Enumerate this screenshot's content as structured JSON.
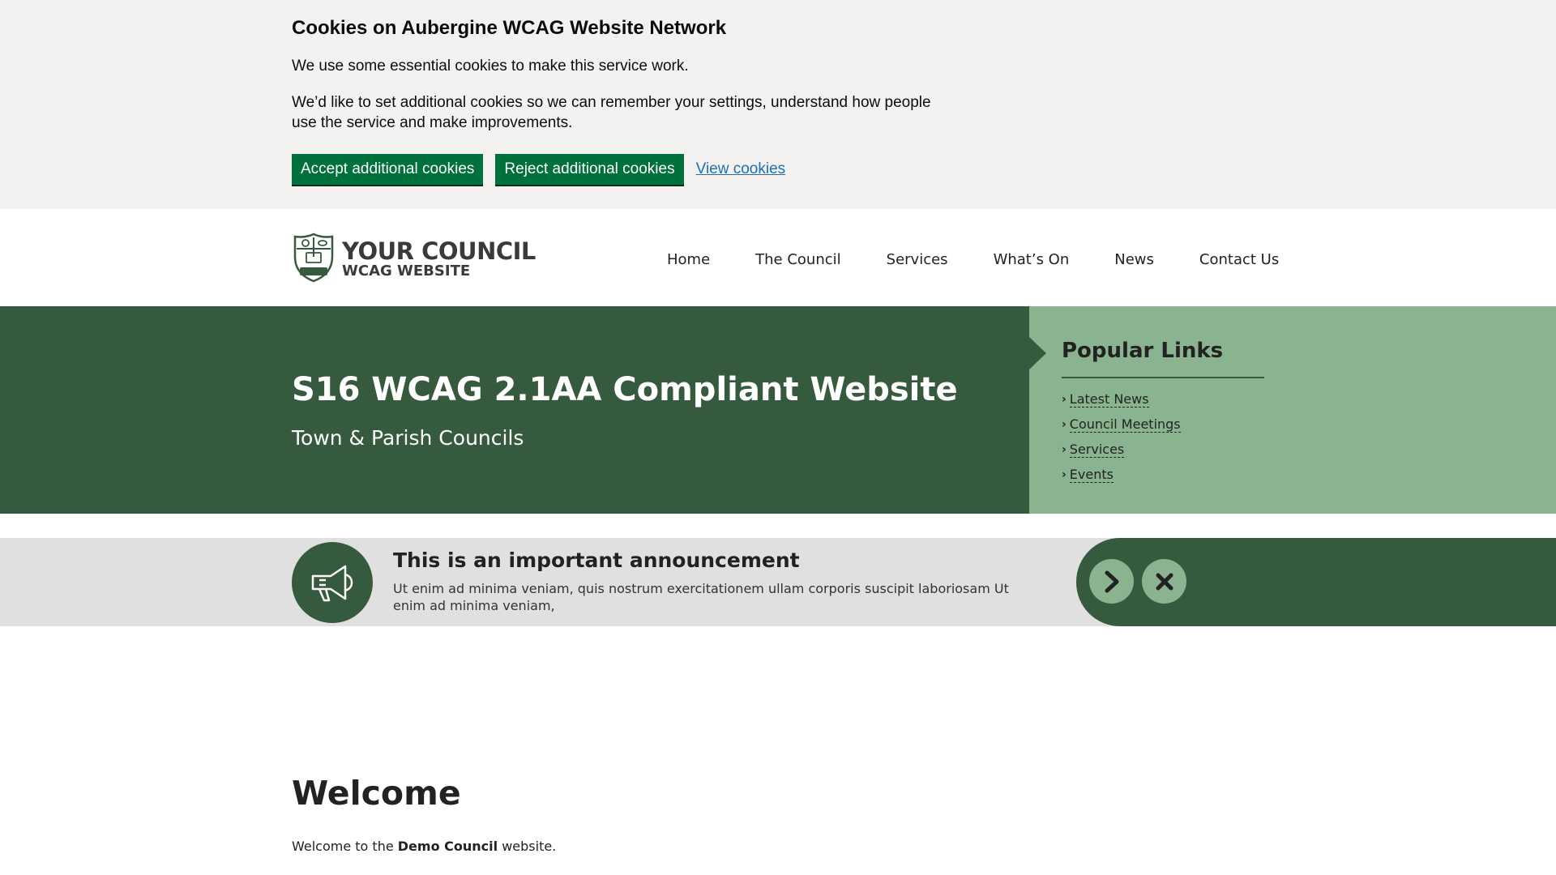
{
  "cookie_banner": {
    "title": "Cookies on Aubergine WCAG Website Network",
    "paragraph1": "We use some essential cookies to make this service work.",
    "paragraph2": "We’d like to set additional cookies so we can remember your settings, understand how people use the service and make improvements.",
    "accept_label": "Accept additional cookies",
    "reject_label": "Reject additional cookies",
    "view_label": "View cookies"
  },
  "header": {
    "logo_line1": "YOUR COUNCIL",
    "logo_line2": "WCAG WEBSITE",
    "logo_badge": "WCAG",
    "nav": [
      "Home",
      "The Council",
      "Services",
      "What’s On",
      "News",
      "Contact Us"
    ]
  },
  "hero": {
    "title": "S16 WCAG 2.1AA Compliant Website",
    "subtitle": "Town & Parish Councils"
  },
  "popular_links": {
    "title": "Popular Links",
    "items": [
      "Latest News",
      "Council Meetings",
      "Services",
      "Events"
    ]
  },
  "announcement": {
    "icon": "megaphone-icon",
    "title": "This is an important announcement",
    "text": "Ut enim ad minima veniam, quis nostrum exercitationem ullam corporis suscipit laboriosam Ut enim ad minima veniam,",
    "next_icon": "chevron-right-icon",
    "close_icon": "close-icon"
  },
  "welcome": {
    "title": "Welcome",
    "text_prefix": "Welcome to the ",
    "text_bold": "Demo Council",
    "text_suffix": " website."
  },
  "colors": {
    "primary_green": "#365a3e",
    "light_green": "#8ab48f",
    "cookie_button": "#00703c",
    "link_blue": "#1d70b8",
    "banner_bg": "#f3f2f1",
    "announce_bg": "#e0e0e0"
  }
}
